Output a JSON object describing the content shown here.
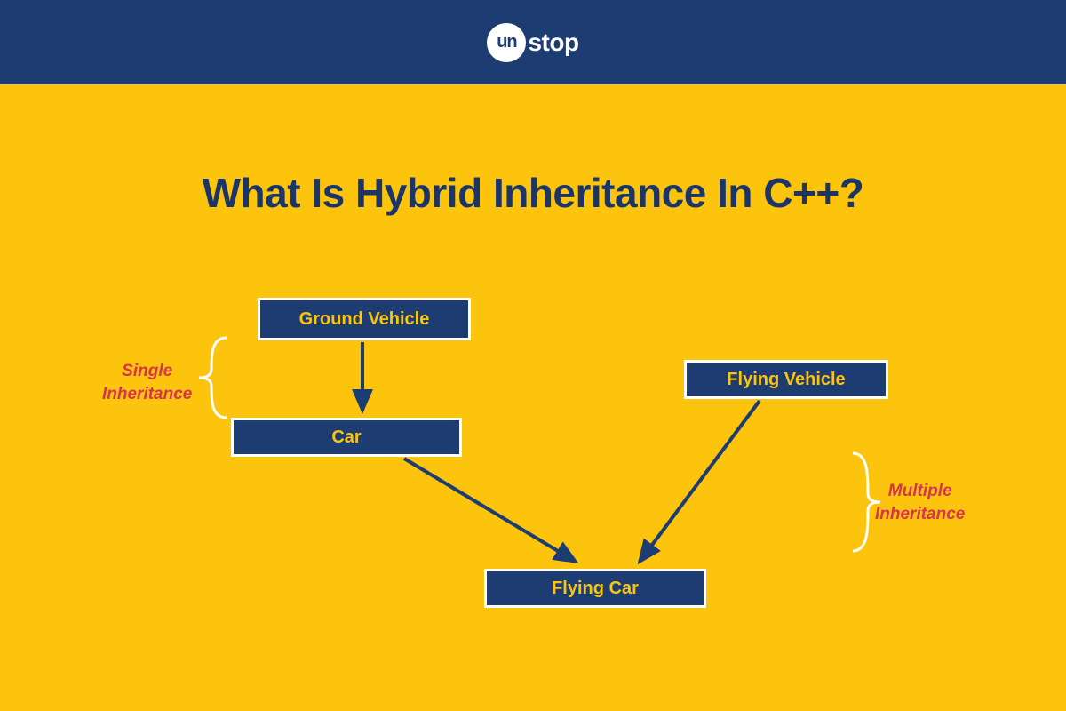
{
  "brand": {
    "circle_text": "un",
    "name_rest": "stop"
  },
  "title": "What Is Hybrid Inheritance In C++?",
  "nodes": {
    "ground_vehicle": "Ground Vehicle",
    "car": "Car",
    "flying_vehicle": "Flying Vehicle",
    "flying_car": "Flying Car"
  },
  "annotations": {
    "single": "Single\nInheritance",
    "multiple": "Multiple\nInheritance"
  },
  "colors": {
    "bg_yellow": "#fcc40d",
    "header_navy": "#1d3c72",
    "title_navy": "#1b3569",
    "anno_red": "#d8344b",
    "white": "#ffffff"
  },
  "diagram_edges": [
    {
      "from": "ground_vehicle",
      "to": "car",
      "relation": "single-inheritance"
    },
    {
      "from": "car",
      "to": "flying_car",
      "relation": "multiple-inheritance"
    },
    {
      "from": "flying_vehicle",
      "to": "flying_car",
      "relation": "multiple-inheritance"
    }
  ]
}
